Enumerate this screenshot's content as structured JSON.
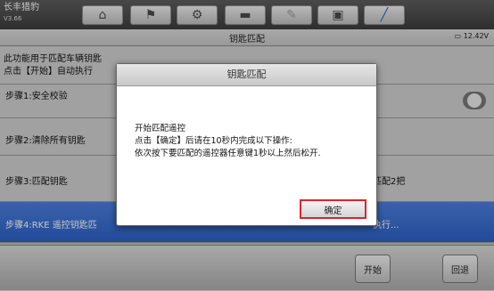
{
  "header": {
    "app_name": "长丰猎豹",
    "version": "V3.66",
    "toolbar": [
      {
        "name": "home-button",
        "icon": "home-icon",
        "glyph": "⌂"
      },
      {
        "name": "car-button",
        "icon": "car-icon",
        "glyph": "⚑"
      },
      {
        "name": "settings-button",
        "icon": "gear-icon",
        "glyph": "⚙"
      },
      {
        "name": "print-button",
        "icon": "printer-icon",
        "glyph": "▬"
      },
      {
        "name": "help-button",
        "icon": "wrench-icon",
        "glyph": "✎"
      },
      {
        "name": "save-button",
        "icon": "save-icon",
        "glyph": "▣"
      },
      {
        "name": "edit-button",
        "icon": "pen-icon",
        "glyph": "╱"
      }
    ]
  },
  "subheader": {
    "title": "钥匙匹配",
    "battery": "12.42V"
  },
  "info": {
    "line1": "此功能用于匹配车辆钥匙",
    "line2": "点击【开始】自动执行"
  },
  "steps": [
    {
      "label": "步骤1:安全校验",
      "status": ""
    },
    {
      "label": "步骤2:清除所有钥匙",
      "status": ""
    },
    {
      "label": "步骤3:匹配钥匙",
      "status": "匹配2把"
    },
    {
      "label": "步骤4:RKE 遥控钥匙匹",
      "status": "执行..."
    }
  ],
  "footer": {
    "start_label": "开始",
    "back_label": "回退"
  },
  "dialog": {
    "title": "钥匙匹配",
    "line1": "开始匹配遥控",
    "line2": "点击【确定】后请在10秒内完成以下操作:",
    "line3": "依次按下要匹配的遥控器任意键1秒以上然后松开.",
    "ok_label": "确定"
  },
  "colors": {
    "active_row": "#2c5fc4",
    "ok_highlight": "#d7262e"
  }
}
